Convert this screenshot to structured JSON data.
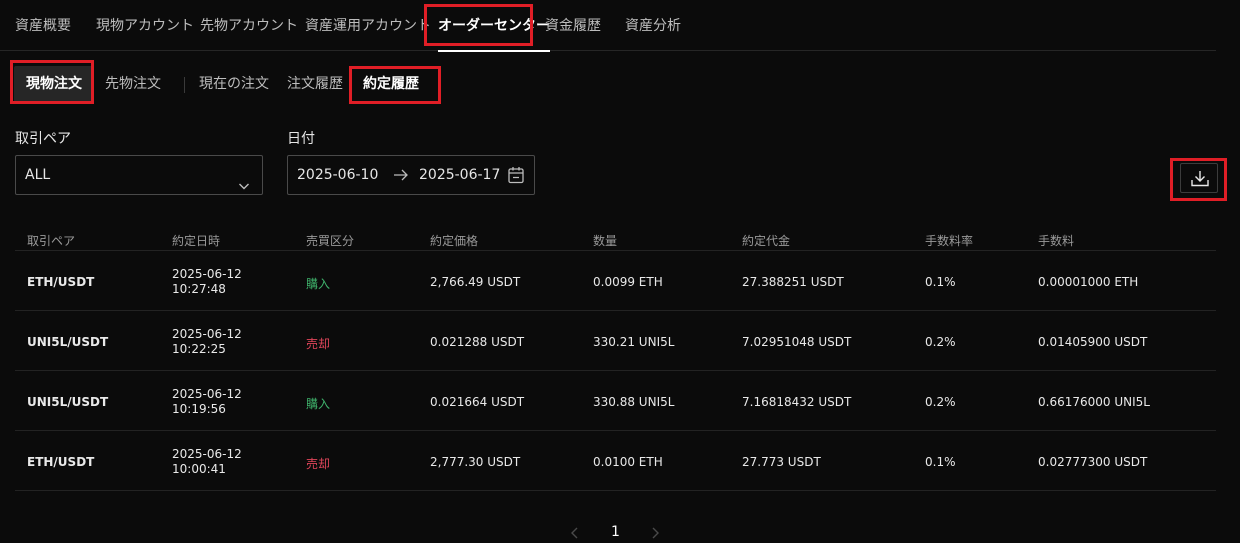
{
  "top_nav": {
    "tabs": [
      "資産概要",
      "現物アカウント",
      "先物アカウント",
      "資産運用アカウント",
      "オーダーセンター",
      "資金履歴",
      "資産分析"
    ],
    "active_index": 4
  },
  "sub_nav": {
    "market_tabs": [
      "現物注文",
      "先物注文"
    ],
    "order_tabs": [
      "現在の注文",
      "注文履歴",
      "約定履歴"
    ]
  },
  "filters": {
    "pair_label": "取引ペア",
    "pair_value": "ALL",
    "date_label": "日付",
    "date_from": "2025-06-10",
    "date_to": "2025-06-17"
  },
  "table": {
    "headers": [
      "取引ペア",
      "約定日時",
      "売買区分",
      "約定価格",
      "数量",
      "約定代金",
      "手数料率",
      "手数料"
    ],
    "rows": [
      {
        "pair": "ETH/USDT",
        "date": "2025-06-12",
        "time": "10:27:48",
        "side": "購入",
        "side_type": "buy",
        "price": "2,766.49 USDT",
        "qty": "0.0099 ETH",
        "amount": "27.388251 USDT",
        "fee_rate": "0.1%",
        "fee": "0.00001000 ETH"
      },
      {
        "pair": "UNI5L/USDT",
        "date": "2025-06-12",
        "time": "10:22:25",
        "side": "売却",
        "side_type": "sell",
        "price": "0.021288 USDT",
        "qty": "330.21 UNI5L",
        "amount": "7.02951048 USDT",
        "fee_rate": "0.2%",
        "fee": "0.01405900 USDT"
      },
      {
        "pair": "UNI5L/USDT",
        "date": "2025-06-12",
        "time": "10:19:56",
        "side": "購入",
        "side_type": "buy",
        "price": "0.021664 USDT",
        "qty": "330.88 UNI5L",
        "amount": "7.16818432 USDT",
        "fee_rate": "0.2%",
        "fee": "0.66176000 UNI5L"
      },
      {
        "pair": "ETH/USDT",
        "date": "2025-06-12",
        "time": "10:00:41",
        "side": "売却",
        "side_type": "sell",
        "price": "2,777.30 USDT",
        "qty": "0.0100 ETH",
        "amount": "27.773 USDT",
        "fee_rate": "0.1%",
        "fee": "0.02777300 USDT"
      }
    ]
  },
  "pagination": {
    "current_page": "1"
  },
  "colors": {
    "buy": "#3fb26b",
    "sell": "#e0455a",
    "highlight": "#e01e26",
    "background": "#0b0b0b"
  }
}
